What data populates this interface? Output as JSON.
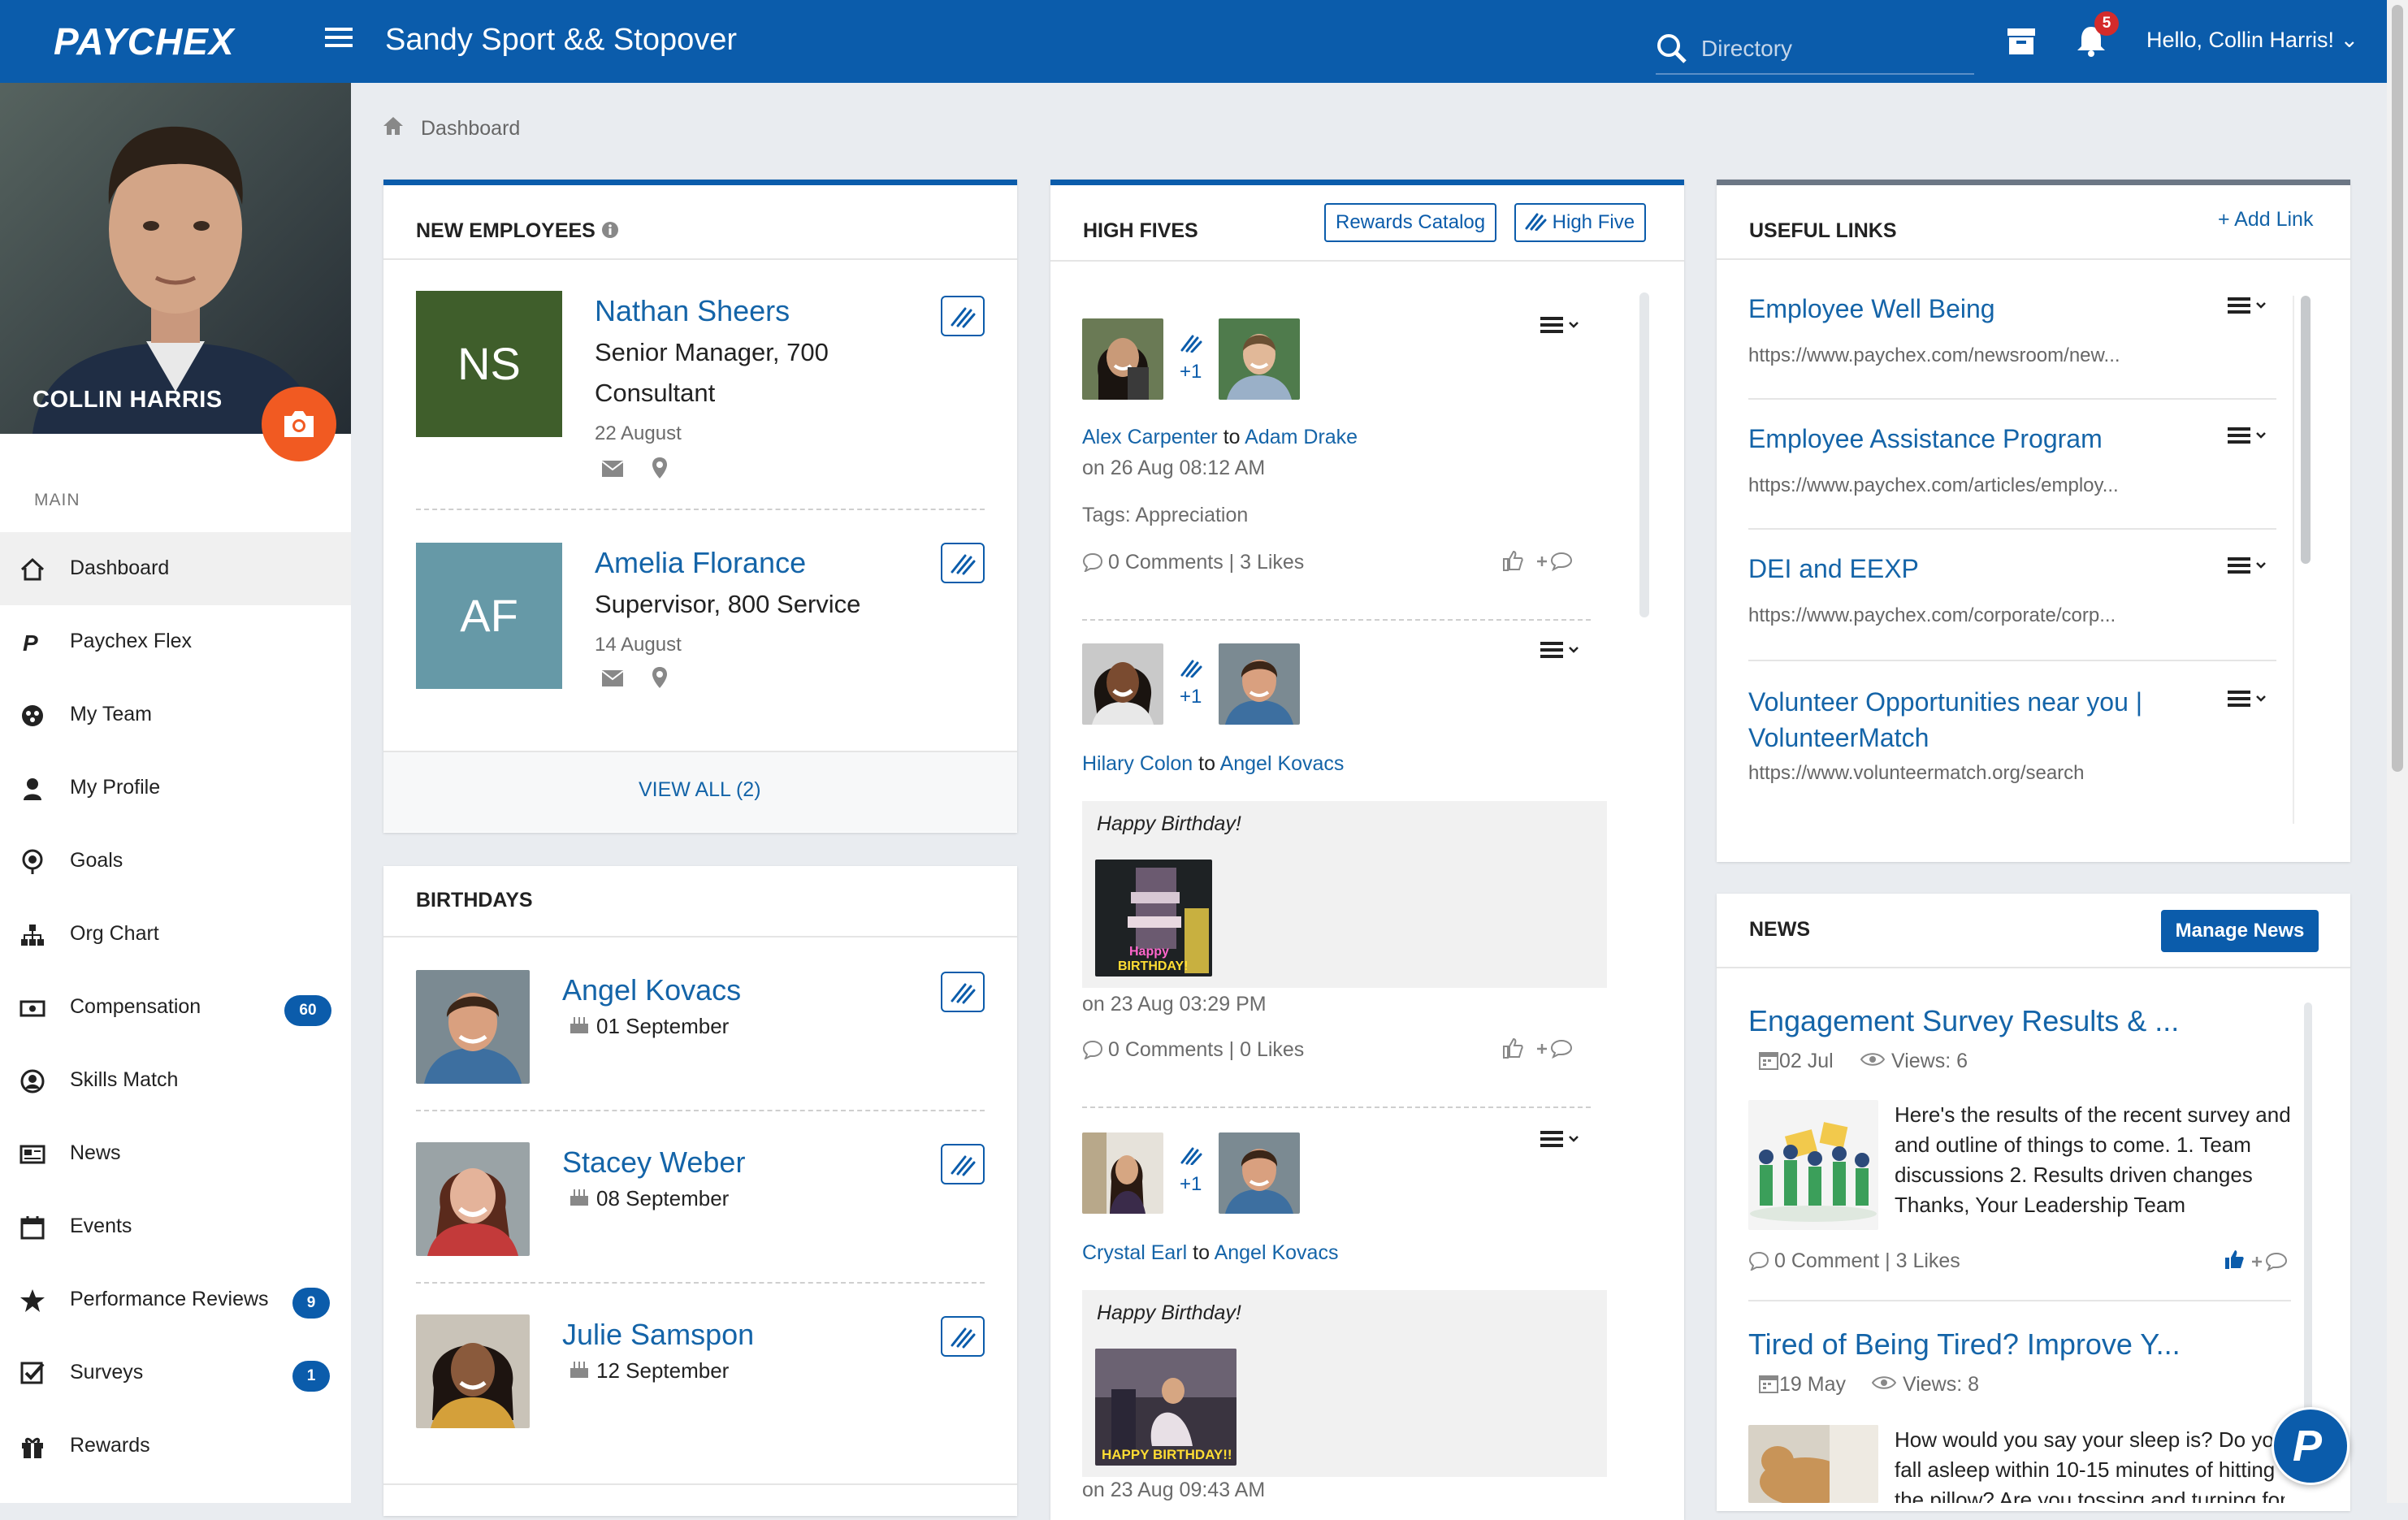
{
  "header": {
    "logo": "PAYCHEX",
    "company_name": "Sandy Sport && Stopover",
    "search_placeholder": "Directory",
    "notification_count": "5",
    "greeting": "Hello, Collin Harris! ⌄"
  },
  "profile": {
    "name": "COLLIN HARRIS"
  },
  "sidebar": {
    "section_label": "MAIN",
    "items": [
      {
        "label": "Dashboard",
        "icon": "home-icon",
        "active": true
      },
      {
        "label": "Paychex Flex",
        "icon": "paychex-p-icon"
      },
      {
        "label": "My Team",
        "icon": "team-icon"
      },
      {
        "label": "My Profile",
        "icon": "person-icon"
      },
      {
        "label": "Goals",
        "icon": "goals-icon"
      },
      {
        "label": "Org Chart",
        "icon": "org-chart-icon"
      },
      {
        "label": "Compensation",
        "icon": "money-icon",
        "badge": "60"
      },
      {
        "label": "Skills Match",
        "icon": "skills-icon"
      },
      {
        "label": "News",
        "icon": "newspaper-icon"
      },
      {
        "label": "Events",
        "icon": "calendar-icon"
      },
      {
        "label": "Performance Reviews",
        "icon": "star-icon",
        "badge": "9"
      },
      {
        "label": "Surveys",
        "icon": "survey-icon",
        "badge": "1"
      },
      {
        "label": "Rewards",
        "icon": "gift-icon"
      }
    ]
  },
  "breadcrumb": {
    "label": "Dashboard"
  },
  "new_employees": {
    "title": "NEW EMPLOYEES",
    "employees": [
      {
        "initials": "NS",
        "name": "Nathan Sheers",
        "role_line1": "Senior Manager, 700",
        "role_line2": "Consultant",
        "date": "22 August",
        "color": "#3f5e2b"
      },
      {
        "initials": "AF",
        "name": "Amelia Florance",
        "role_line1": "Supervisor, 800 Service",
        "date": "14 August",
        "color": "#6699a7"
      }
    ],
    "view_all": "VIEW ALL (2)"
  },
  "birthdays": {
    "title": "BIRTHDAYS",
    "people": [
      {
        "name": "Angel Kovacs",
        "date": "01 September"
      },
      {
        "name": "Stacey Weber",
        "date": "08 September"
      },
      {
        "name": "Julie Samspon",
        "date": "12 September"
      }
    ]
  },
  "high_fives": {
    "title": "HIGH FIVES",
    "rewards_button": "Rewards Catalog",
    "high_five_button": "High Five",
    "plus_one": "+1",
    "to": "to",
    "posts": [
      {
        "from": "Alex Carpenter",
        "to": "Adam Drake",
        "time": "on 26 Aug 08:12 AM",
        "tags": "Tags: Appreciation",
        "stats": "0 Comments | 3 Likes"
      },
      {
        "from": "Hilary Colon",
        "to": "Angel Kovacs",
        "message": "Happy Birthday!",
        "time": "on 23 Aug 03:29 PM",
        "stats": "0 Comments | 0 Likes"
      },
      {
        "from": "Crystal Earl",
        "to": "Angel Kovacs",
        "message": "Happy Birthday!",
        "time": "on 23 Aug 09:43 AM"
      }
    ]
  },
  "useful_links": {
    "title": "USEFUL LINKS",
    "add_link": "+ Add Link",
    "links": [
      {
        "title": "Employee Well Being",
        "url": "https://www.paychex.com/newsroom/new..."
      },
      {
        "title": "Employee Assistance Program",
        "url": "https://www.paychex.com/articles/employ..."
      },
      {
        "title": "DEI and EEXP",
        "url": "https://www.paychex.com/corporate/corp..."
      },
      {
        "title_line1": "Volunteer Opportunities near you |",
        "title_line2": "VolunteerMatch",
        "url": "https://www.volunteermatch.org/search"
      }
    ]
  },
  "news": {
    "title": "NEWS",
    "manage_button": "Manage News",
    "articles": [
      {
        "title": "Engagement Survey Results & ...",
        "date": "02 Jul",
        "views": "Views: 6",
        "body": [
          "Here's the results of the recent survey and",
          "and outline of things to come. 1. Team",
          "discussions 2. Results driven changes",
          "Thanks, Your Leadership Team"
        ],
        "stats": "0 Comment | 3 Likes"
      },
      {
        "title": "Tired of Being Tired? Improve Y...",
        "date": "19 May",
        "views": "Views: 8",
        "body": [
          "How would you say your sleep is? Do you",
          "fall asleep within 10-15 minutes of hitting",
          "the pillow? Are you tossing and turning for"
        ]
      }
    ]
  },
  "colors": {
    "brand": "#0b5cab",
    "accent": "#f15a22",
    "badge": "#d42b2b"
  }
}
